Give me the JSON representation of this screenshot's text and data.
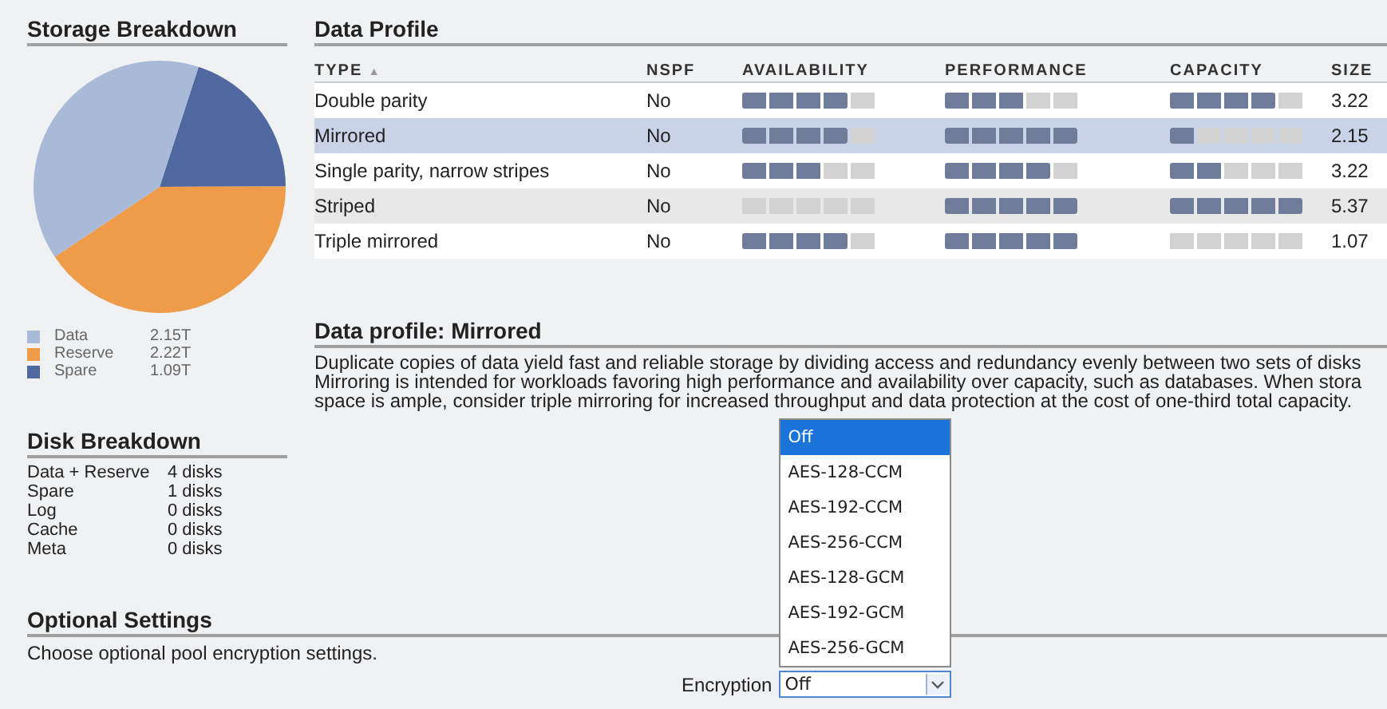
{
  "storage_breakdown": {
    "title": "Storage Breakdown",
    "chart_data": {
      "type": "pie",
      "categories": [
        "Data",
        "Reserve",
        "Spare"
      ],
      "values": [
        39.38,
        40.66,
        19.96
      ]
    },
    "legend": [
      {
        "value": "2.15T",
        "color": "#a9b9d8"
      },
      {
        "value": "2.22T",
        "color": "#ee9c4a"
      },
      {
        "value": "1.09T",
        "color": "#4f68a0"
      }
    ]
  },
  "disk_breakdown": {
    "title": "Disk Breakdown",
    "rows": [
      {
        "label": "Data + Reserve",
        "value": "4 disks"
      },
      {
        "label": "Spare",
        "value": "1 disks"
      },
      {
        "label": "Log",
        "value": "0 disks"
      },
      {
        "label": "Cache",
        "value": "0 disks"
      },
      {
        "label": "Meta",
        "value": "0 disks"
      }
    ]
  },
  "data_profile": {
    "title": "Data Profile",
    "columns": [
      "TYPE",
      "NSPF",
      "AVAILABILITY",
      "PERFORMANCE",
      "CAPACITY",
      "SIZE"
    ],
    "sort_icon": "▲",
    "rows": [
      {
        "type": "Double parity",
        "nspf": "No",
        "availability": {
          "level": 0.8
        },
        "performance": {
          "level": 0.6
        },
        "capacity": {
          "level": 0.8
        },
        "size": "3.22",
        "selected": false
      },
      {
        "type": "Mirrored",
        "nspf": "No",
        "availability": {
          "level": 0.8
        },
        "performance": {
          "level": 1
        },
        "capacity": {
          "level": 0.2
        },
        "size": "2.15",
        "selected": true
      },
      {
        "type": "Single parity, narrow stripes",
        "nspf": "No",
        "availability": {
          "level": 0.6
        },
        "performance": {
          "level": 0.8
        },
        "capacity": {
          "level": 0.4
        },
        "size": "3.22",
        "selected": false
      },
      {
        "type": "Striped",
        "nspf": "No",
        "availability": {
          "level": 0
        },
        "performance": {
          "level": 1
        },
        "capacity": {
          "level": 1
        },
        "size": "5.37",
        "selected": false
      },
      {
        "type": "Triple mirrored",
        "nspf": "No",
        "availability": {
          "level": 0.8
        },
        "performance": {
          "level": 1
        },
        "capacity": {
          "level": 0
        },
        "size": "1.07",
        "selected": false
      }
    ]
  },
  "profile_detail": {
    "title": "Data profile: Mirrored",
    "description": "Duplicate copies of data yield fast and reliable storage by dividing access and redundancy evenly between two sets of disks\nMirroring is intended for workloads favoring high performance and availability over capacity, such as databases. When stora\nspace is ample, consider triple mirroring for increased throughput and data protection at the cost of one-third total capacity."
  },
  "optional_settings": {
    "title": "Optional Settings",
    "description": "Choose optional pool encryption settings.",
    "encryption": {
      "label": "Encryption",
      "value": "Off",
      "expanded": true,
      "options": [
        {
          "label": "Off",
          "selected": true
        },
        {
          "label": "AES-128-CCM",
          "selected": false
        },
        {
          "label": "AES-192-CCM",
          "selected": false
        },
        {
          "label": "AES-256-CCM",
          "selected": false
        },
        {
          "label": "AES-128-GCM",
          "selected": false
        },
        {
          "label": "AES-192-GCM",
          "selected": false
        },
        {
          "label": "AES-256-GCM",
          "selected": false
        }
      ]
    }
  }
}
